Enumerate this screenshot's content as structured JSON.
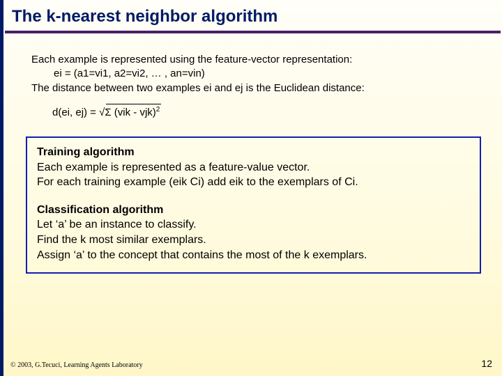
{
  "title": "The k-nearest neighbor algorithm",
  "intro": {
    "line1": "Each example is represented using the feature-vector representation:",
    "line2": "ei = (a1=vi1, a2=vi2, … , an=vin)",
    "line3": "The distance between two examples ei and ej is the Euclidean distance:"
  },
  "formula": {
    "lhs": "d(ei, ej) = ",
    "radical": "√",
    "sum": "Σ (vik - vjk)",
    "exp": "2"
  },
  "algo": {
    "training_title": "Training algorithm",
    "training_l1": "Each example is represented as a feature-value vector.",
    "training_l2": "For each training example (eik Ci) add eik to the exemplars of Ci.",
    "class_title": "Classification algorithm",
    "class_l1": "Let ‘a’ be an instance to classify.",
    "class_l2": "Find the k most similar exemplars.",
    "class_l3": "Assign ‘a’ to the concept that contains the most of the k exemplars."
  },
  "footer": {
    "credit": "© 2003, G.Tecuci, Learning Agents Laboratory",
    "page": "12"
  }
}
